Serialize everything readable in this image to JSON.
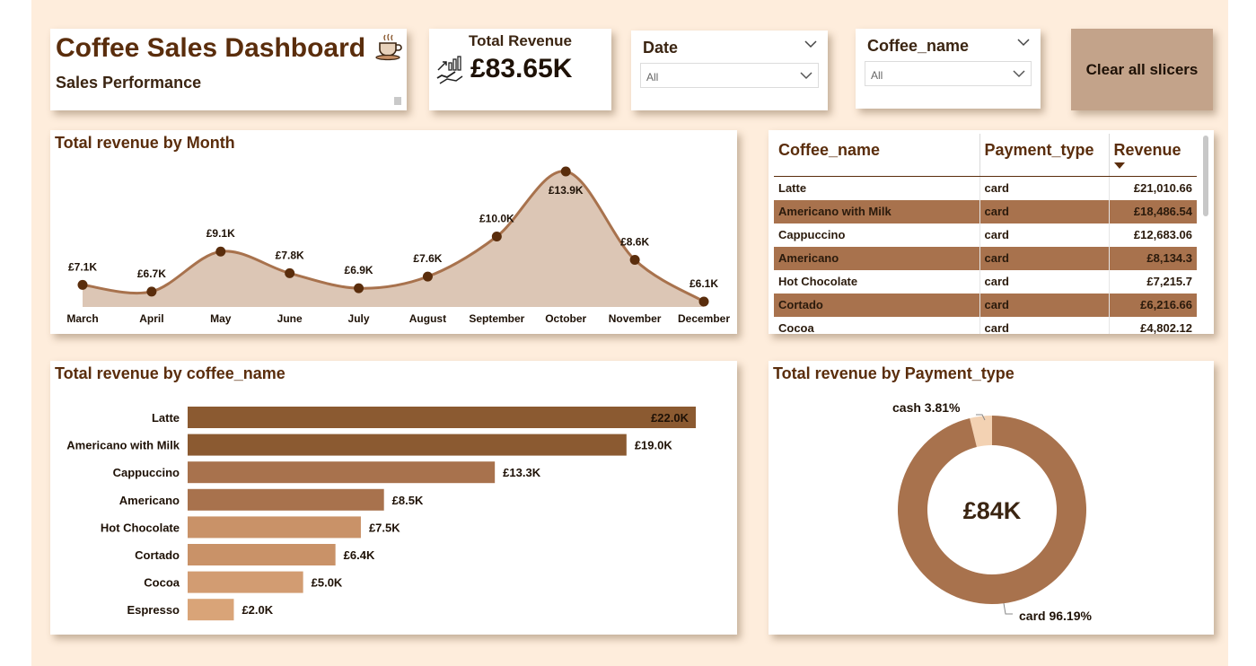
{
  "header": {
    "title": "Coffee Sales Dashboard",
    "subtitle": "Sales Performance",
    "icon": "coffee-cup-icon"
  },
  "kpi": {
    "label": "Total Revenue",
    "value": "£83.65K",
    "icon": "revenue-growth-icon"
  },
  "slicers": {
    "date": {
      "label": "Date",
      "value": "All"
    },
    "coffee_name": {
      "label": "Coffee_name",
      "value": "All"
    }
  },
  "clear_button": {
    "label": "Clear all slicers"
  },
  "colors": {
    "background": "#feeddc",
    "accent_dark": "#8b5a31",
    "accent_mid": "#a8724d",
    "accent_light": "#c99268",
    "accent_pale": "#d9a478",
    "area_fill": "#dcc6b5",
    "line": "#a8724d",
    "marker": "#5a2d0c",
    "title_text": "#5a2d0c"
  },
  "month_chart": {
    "title": "Total revenue by Month",
    "chart_data": {
      "type": "area",
      "categories": [
        "March",
        "April",
        "May",
        "June",
        "July",
        "August",
        "September",
        "October",
        "November",
        "December"
      ],
      "values": [
        7.1,
        6.7,
        9.1,
        7.8,
        6.9,
        7.6,
        10.0,
        13.9,
        8.6,
        6.1
      ],
      "labels": [
        "£7.1K",
        "£6.7K",
        "£9.1K",
        "£7.8K",
        "£6.9K",
        "£7.6K",
        "£10.0K",
        "£13.9K",
        "£8.6K",
        "£6.1K"
      ],
      "unit": "thousand GBP",
      "grid": false
    }
  },
  "table": {
    "columns": [
      "Coffee_name",
      "Payment_type",
      "Revenue"
    ],
    "sort_icon": "sort-descending-icon",
    "rows": [
      [
        "Latte",
        "card",
        "£21,010.66"
      ],
      [
        "Americano with Milk",
        "card",
        "£18,486.54"
      ],
      [
        "Cappuccino",
        "card",
        "£12,683.06"
      ],
      [
        "Americano",
        "card",
        "£8,134.3"
      ],
      [
        "Hot Chocolate",
        "card",
        "£7,215.7"
      ],
      [
        "Cortado",
        "card",
        "£6,216.66"
      ],
      [
        "Cocoa",
        "card",
        "£4,802.12"
      ]
    ]
  },
  "coffee_chart": {
    "title": "Total revenue by coffee_name",
    "chart_data": {
      "type": "bar",
      "orientation": "horizontal",
      "categories": [
        "Latte",
        "Americano with Milk",
        "Cappuccino",
        "Americano",
        "Hot Chocolate",
        "Cortado",
        "Cocoa",
        "Espresso"
      ],
      "values": [
        22.0,
        19.0,
        13.3,
        8.5,
        7.5,
        6.4,
        5.0,
        2.0
      ],
      "labels": [
        "£22.0K",
        "£19.0K",
        "£13.3K",
        "£8.5K",
        "£7.5K",
        "£6.4K",
        "£5.0K",
        "£2.0K"
      ],
      "bar_colors": [
        "#8b5a31",
        "#8b5a31",
        "#a8724d",
        "#a8724d",
        "#c99268",
        "#c99268",
        "#d29c72",
        "#d9a478"
      ],
      "unit": "thousand GBP",
      "grid": false
    }
  },
  "payment_chart": {
    "title": "Total revenue by Payment_type",
    "center_label": "£84K",
    "chart_data": {
      "type": "pie",
      "style": "donut",
      "categories": [
        "card",
        "cash"
      ],
      "values": [
        96.19,
        3.81
      ],
      "labels": [
        "card 96.19%",
        "cash 3.81%"
      ],
      "colors": [
        "#a8724d",
        "#f3d2b3"
      ]
    }
  }
}
